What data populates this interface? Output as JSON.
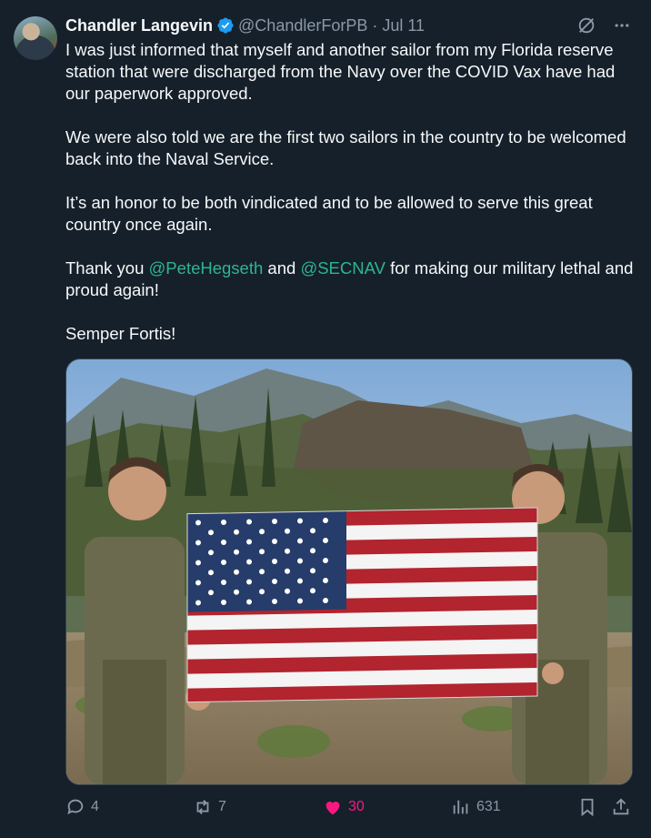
{
  "author": {
    "name": "Chandler Langevin",
    "handle": "@ChandlerForPB",
    "separator": "·",
    "date": "Jul 11"
  },
  "icons": {
    "verified": "verified-badge-icon",
    "grok": "grok-icon",
    "more": "more-icon",
    "reply": "reply-icon",
    "retweet": "retweet-icon",
    "like": "heart-icon",
    "views": "views-icon",
    "bookmark": "bookmark-icon",
    "share": "share-icon"
  },
  "body": {
    "p1": "I was just informed that myself and another sailor from my Florida reserve station that were discharged from the Navy over the COVID Vax have had our paperwork approved.",
    "p2": "We were also told we are the first two sailors in the country to be welcomed back into the Naval Service.",
    "p3": "It’s an honor to be both vindicated and to be allowed to serve this great country once again.",
    "p4_prefix": "Thank you",
    "mention1": "@PeteHegseth",
    "p4_and": "and",
    "mention2": "@SECNAV",
    "p4_suffix": "for making our military lethal and proud again!",
    "p5": "Semper Fortis!"
  },
  "stats": {
    "replies": "4",
    "retweets": "7",
    "likes": "30",
    "views": "631"
  },
  "colors": {
    "background": "#15202b",
    "mention": "#2fb58f",
    "like": "#f91880",
    "muted": "#8b98a5"
  }
}
